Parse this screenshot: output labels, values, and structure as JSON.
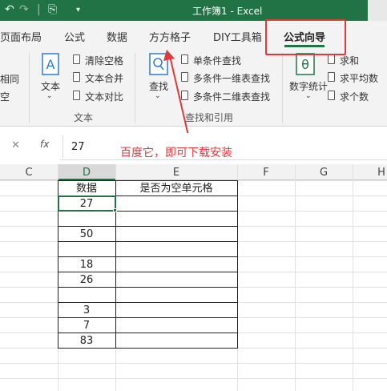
{
  "window": {
    "title": "工作簿1  -  Excel"
  },
  "quick_access": {
    "undo_icon": "undo-icon",
    "redo_icon": "redo-icon",
    "save_icon": "save-icon"
  },
  "tabs": [
    {
      "label": "页面布局"
    },
    {
      "label": "公式"
    },
    {
      "label": "数据"
    },
    {
      "label": "方方格子"
    },
    {
      "label": "DIY工具箱"
    },
    {
      "label": "公式向导"
    }
  ],
  "ribbon": {
    "left_partial": [
      "相同",
      "空"
    ],
    "text_group": {
      "text_button": "文本",
      "items": [
        "清除空格",
        "文本合并",
        "文本对比"
      ],
      "group_label": "文本"
    },
    "lookup_group": {
      "find_button": "查找",
      "items": [
        "单条件查找",
        "多条件一维表查找",
        "多条件二维表查找"
      ],
      "group_label": "查找和引用"
    },
    "stats_group": {
      "button": "数字统计",
      "items": [
        "求和",
        "求平均数",
        "求个数"
      ]
    }
  },
  "formula_bar": {
    "value": "27",
    "fx_label": "fx"
  },
  "annotation": "百度它，即可下载安装",
  "columns": [
    "C",
    "D",
    "E",
    "F",
    "G",
    "H"
  ],
  "table": {
    "header_d": "数据",
    "header_e": "是否为空单元格",
    "values": [
      "27",
      "",
      "50",
      "",
      "18",
      "26",
      "",
      "3",
      "7",
      "83"
    ]
  },
  "colors": {
    "excel_green": "#217346",
    "annotation_red": "#e0393a"
  }
}
